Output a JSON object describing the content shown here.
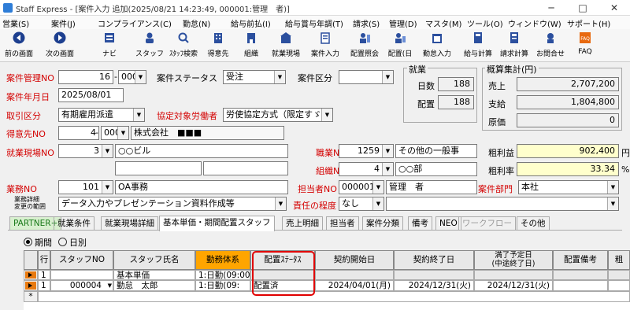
{
  "window": {
    "title": "Staff Express - [案件入力 追加(2025/08/21 14:23:49, 000001:管理　者)]"
  },
  "menu": [
    "営業(S)",
    "案件(J)",
    "コンプライアンス(C)",
    "勤怠(N)",
    "給与前払(I)",
    "給与賞与年調(T)",
    "請求(S)",
    "管理(D)",
    "マスタ(M)",
    "ツール(O)",
    "ウィンドウ(W)",
    "サポート(H)"
  ],
  "toolbar": {
    "prev": "前の画面",
    "next": "次の画面",
    "navi": "ナビ",
    "staff": "スタッフ",
    "staff_search": "ｽﾀｯﾌ検索",
    "client": "得意先",
    "org": "組織",
    "site": "就業現場",
    "case_input": "案件入力",
    "assign_view": "配置照会",
    "assign_day": "配置(日",
    "attend_input": "勤怠入力",
    "pay_calc": "給与計算",
    "bill_calc": "請求計算",
    "contact": "お問合せ",
    "faq": "FAQ"
  },
  "form": {
    "case_no_label": "案件管理NO",
    "case_no": "16",
    "case_no_branch": "000",
    "status_label": "案件ステータス",
    "status": "受注",
    "case_type_label": "案件区分",
    "case_type": "",
    "case_ym_label": "案件年月日",
    "case_ym": "2025/08/01",
    "trade_label": "取引区分",
    "trade": "有期雇用派遣",
    "agreement_label": "協定対象労働者",
    "agreement": "労使協定方式（限定すゞ",
    "client_label": "得意先NO",
    "client_no": "4",
    "client_branch": "000",
    "client_name": "株式会社　■■■",
    "site_label": "就業現場NO",
    "site_no": "3",
    "site_name": "○○ビル",
    "job_label": "職業NO",
    "job_no": "1259",
    "job_name": "その他の一般事",
    "orgunit_label": "組織NO",
    "org_no": "4",
    "org_name": "○○部",
    "business_label": "業務NO",
    "business_no": "101",
    "business_name": "OA事務",
    "owner_label": "担当者NO",
    "owner_no": "000001",
    "owner_name": "管理　者",
    "dept_label": "案件部門",
    "dept": "本社",
    "detail_label_1": "業務詳細",
    "detail_label_2": "変更の範囲",
    "detail": "データ入力やプレゼンテーション資料作成等",
    "resp_label": "責任の程度",
    "resp": "なし"
  },
  "employment": {
    "title": "就業",
    "days_label": "日数",
    "days": "188",
    "assign_label": "配置",
    "assign": "188"
  },
  "estimate": {
    "title": "概算集計(円)",
    "sales_label": "売上",
    "sales": "2,707,200",
    "pay_label": "支給",
    "pay": "1,804,800",
    "cost_label": "原価",
    "cost": "0",
    "gross_label": "粗利益",
    "gross": "902,400",
    "gross_unit": "円",
    "rate_label": "粗利率",
    "rate": "33.34",
    "rate_unit": "%"
  },
  "tabs": [
    "PARTNER+",
    "就業条件",
    "就業現場詳細",
    "基本単価・期間配置スタッフ",
    "売上明細",
    "担当者",
    "案件分類",
    "備考",
    "NEO",
    "ワークフロー",
    "その他"
  ],
  "period": {
    "option1": "期間",
    "option2": "日別"
  },
  "grid": {
    "headers": [
      "行",
      "スタッフNO",
      "スタッフ氏名",
      "勤務体系",
      "配置ｽﾃｰﾀｽ",
      "契約開始日",
      "契約終了日",
      "満了予定日\n(中途終了日)",
      "配置備考",
      "粗"
    ],
    "rows": [
      {
        "row": "1",
        "staff_no": "",
        "staff_name": "基本単価",
        "schedule": "1:日勤(09:00-",
        "status": "",
        "start": "",
        "end": "",
        "expiry": "",
        "note": ""
      },
      {
        "row": "1",
        "staff_no": "000004",
        "staff_name": "勤怠　太郎",
        "schedule": "1:日勤(09:",
        "status": "配置済",
        "start": "2024/04/01(月)",
        "end": "2024/12/31(火)",
        "expiry": "2024/12/31(火)",
        "note": ""
      }
    ],
    "new_row_marker": "*"
  }
}
